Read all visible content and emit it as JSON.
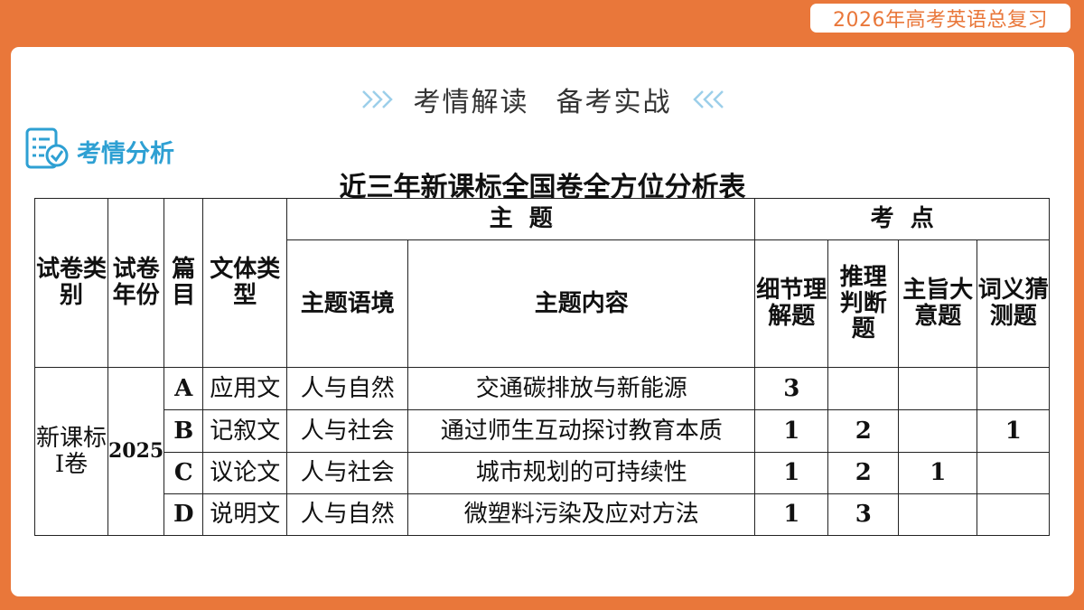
{
  "badge": "2026年高考英语总复习",
  "heading": {
    "left": "考情解读",
    "right": "备考实战"
  },
  "section_label": "考情分析",
  "table_title": "近三年新课标全国卷全方位分析表",
  "table": {
    "headers": {
      "paper_type": "试卷类别",
      "paper_year": "试卷年份",
      "passage": "篇目",
      "genre": "文体类型",
      "theme_group": "主  题",
      "theme_context": "主题语境",
      "theme_content": "主题内容",
      "points_group": "考  点",
      "detail": "细节理解题",
      "inference": "推理判断题",
      "main_idea": "主旨大意题",
      "vocab": "词义猜测题"
    },
    "paper_type_value": "新课标Ⅰ卷",
    "paper_year_value": "2025",
    "rows": [
      {
        "passage": "A",
        "genre": "应用文",
        "context": "人与自然",
        "content": "交通碳排放与新能源",
        "detail": "3",
        "inference": "",
        "main_idea": "",
        "vocab": ""
      },
      {
        "passage": "B",
        "genre": "记叙文",
        "context": "人与社会",
        "content": "通过师生互动探讨教育本质",
        "detail": "1",
        "inference": "2",
        "main_idea": "",
        "vocab": "1"
      },
      {
        "passage": "C",
        "genre": "议论文",
        "context": "人与社会",
        "content": "城市规划的可持续性",
        "detail": "1",
        "inference": "2",
        "main_idea": "1",
        "vocab": ""
      },
      {
        "passage": "D",
        "genre": "说明文",
        "context": "人与自然",
        "content": "微塑料污染及应对方法",
        "detail": "1",
        "inference": "3",
        "main_idea": "",
        "vocab": ""
      }
    ]
  },
  "colors": {
    "frame": "#E9773A",
    "accent_blue": "#2EA0D3",
    "chevron": "#9CCFEA"
  },
  "icons": {
    "section": "checklist-icon",
    "left_decor": "chevron-right-icon",
    "right_decor": "chevron-left-icon"
  }
}
